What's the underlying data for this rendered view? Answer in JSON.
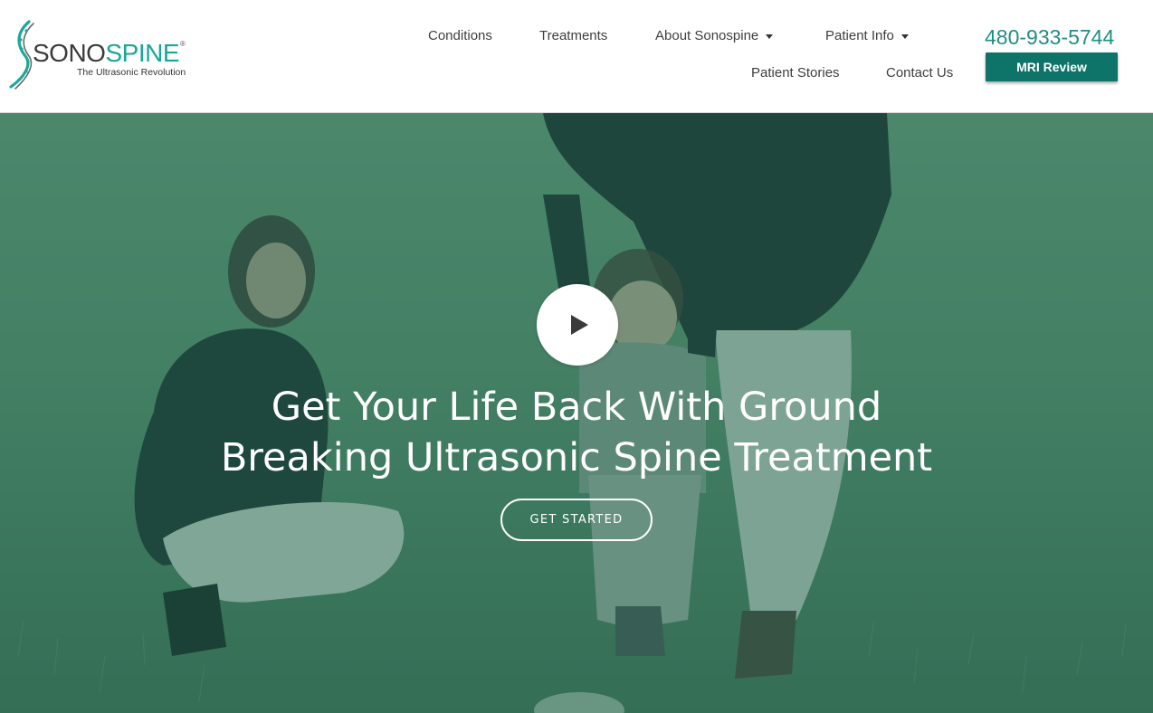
{
  "brand": {
    "name_part1": "SONO",
    "name_part2": "SPINE",
    "registered": "®",
    "tagline": "The Ultrasonic Revolution"
  },
  "nav": {
    "conditions": "Conditions",
    "treatments": "Treatments",
    "about": "About Sonospine",
    "patient_info": "Patient Info",
    "patient_stories": "Patient Stories",
    "contact": "Contact Us"
  },
  "contact": {
    "phone": "480-933-5744",
    "mri_button": "MRI Review"
  },
  "hero": {
    "headline_line1": "Get Your Life Back With Ground",
    "headline_line2": "Breaking Ultrasonic Spine Treatment",
    "cta": "GET STARTED"
  },
  "colors": {
    "accent": "#19a79a",
    "button": "#0e7368",
    "overlay": "#1c6e5a"
  },
  "icons": {
    "logo": "spine-logo-icon",
    "play": "play-icon",
    "dropdown": "caret-down-icon"
  }
}
